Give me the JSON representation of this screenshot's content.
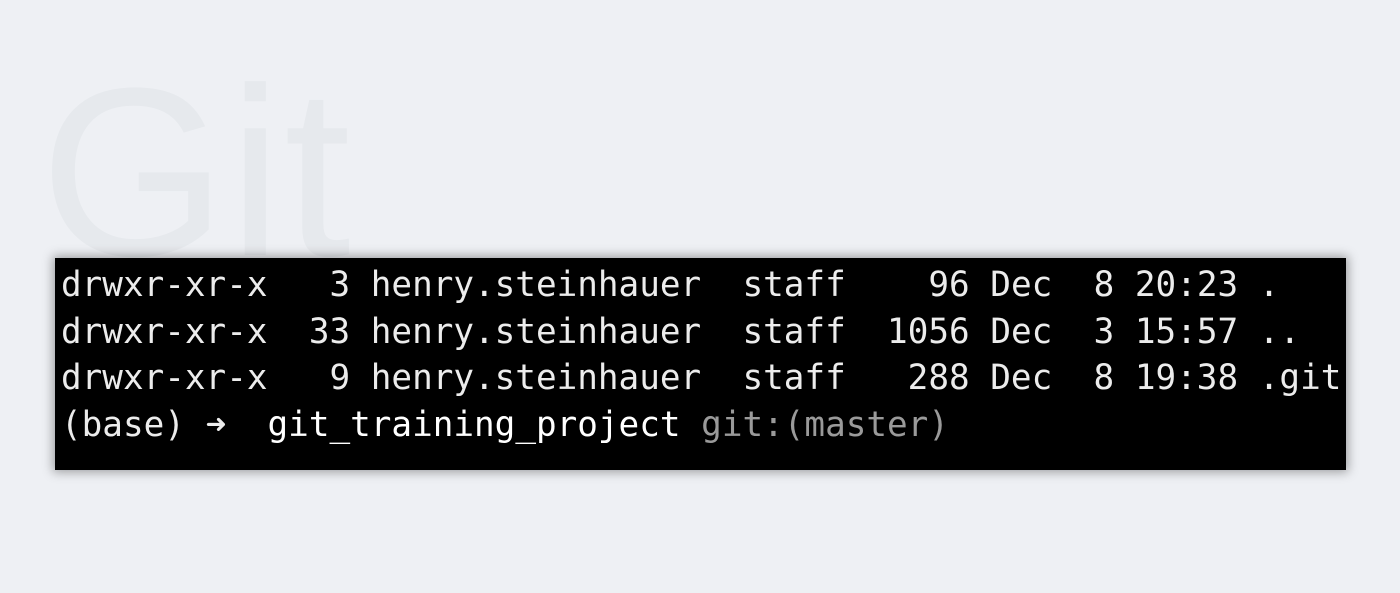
{
  "background": {
    "watermark_text": "Git",
    "background_color": "#eef0f4"
  },
  "terminal": {
    "background_color": "#000000",
    "text_color": "#ececec",
    "entries": [
      {
        "perms": "drwxr-xr-x",
        "links": "3",
        "owner": "henry.steinhauer",
        "group": "staff",
        "size": "96",
        "month": "Dec",
        "day": "8",
        "time": "20:23",
        "name": "."
      },
      {
        "perms": "drwxr-xr-x",
        "links": "33",
        "owner": "henry.steinhauer",
        "group": "staff",
        "size": "1056",
        "month": "Dec",
        "day": "3",
        "time": "15:57",
        "name": ".."
      },
      {
        "perms": "drwxr-xr-x",
        "links": "9",
        "owner": "henry.steinhauer",
        "group": "staff",
        "size": "288",
        "month": "Dec",
        "day": "8",
        "time": "19:38",
        "name": ".git"
      }
    ],
    "prompt": {
      "env": "(base)",
      "arrow": "➜",
      "directory": "git_training_project",
      "git_label": "git:(master)"
    }
  }
}
